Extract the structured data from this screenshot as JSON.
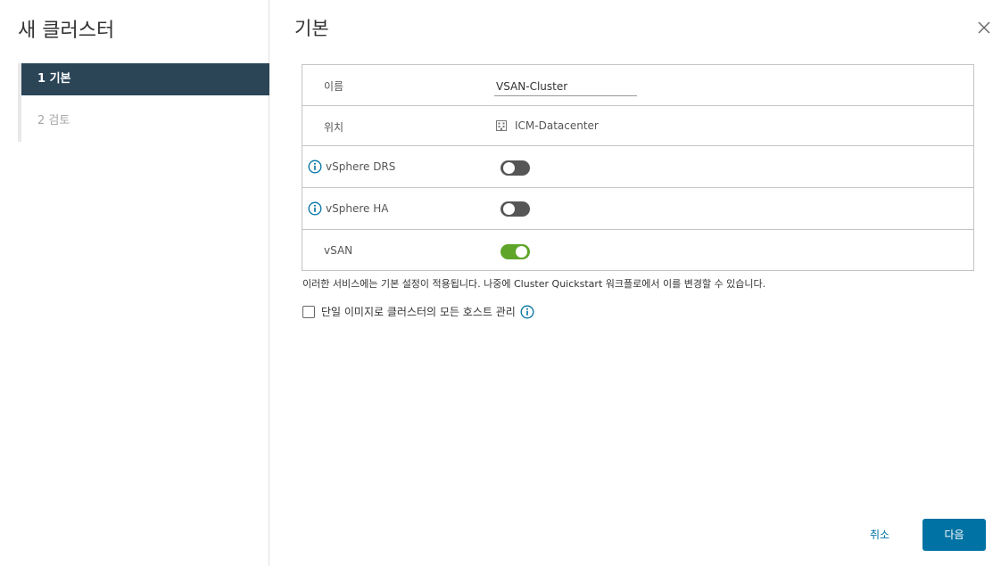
{
  "sidebar": {
    "title": "새 클러스터",
    "steps": [
      {
        "label": "1  기본",
        "active": true
      },
      {
        "label": "2  검토",
        "active": false
      }
    ]
  },
  "main": {
    "title": "기본",
    "close_icon": "close-icon"
  },
  "form": {
    "name": {
      "label": "이름",
      "value": "VSAN-Cluster"
    },
    "location": {
      "label": "위치",
      "value": "ICM-Datacenter",
      "icon": "datacenter-icon"
    },
    "drs": {
      "label": "vSphere DRS",
      "enabled": false
    },
    "ha": {
      "label": "vSphere HA",
      "enabled": false
    },
    "vsan": {
      "label": "vSAN",
      "enabled": true
    }
  },
  "note": "이러한 서비스에는 기본 설정이 적용됩니다. 나중에 Cluster Quickstart 워크플로에서 이를 변경할 수 있습니다.",
  "image_mgmt": {
    "label": "단일 이미지로 클러스터의 모든 호스트 관리",
    "checked": false
  },
  "footer": {
    "cancel_label": "취소",
    "next_label": "다음"
  },
  "colors": {
    "accent": "#0072a3",
    "active_step_bg": "#2b4557",
    "toggle_on": "#5ea529",
    "toggle_off": "#565656"
  }
}
